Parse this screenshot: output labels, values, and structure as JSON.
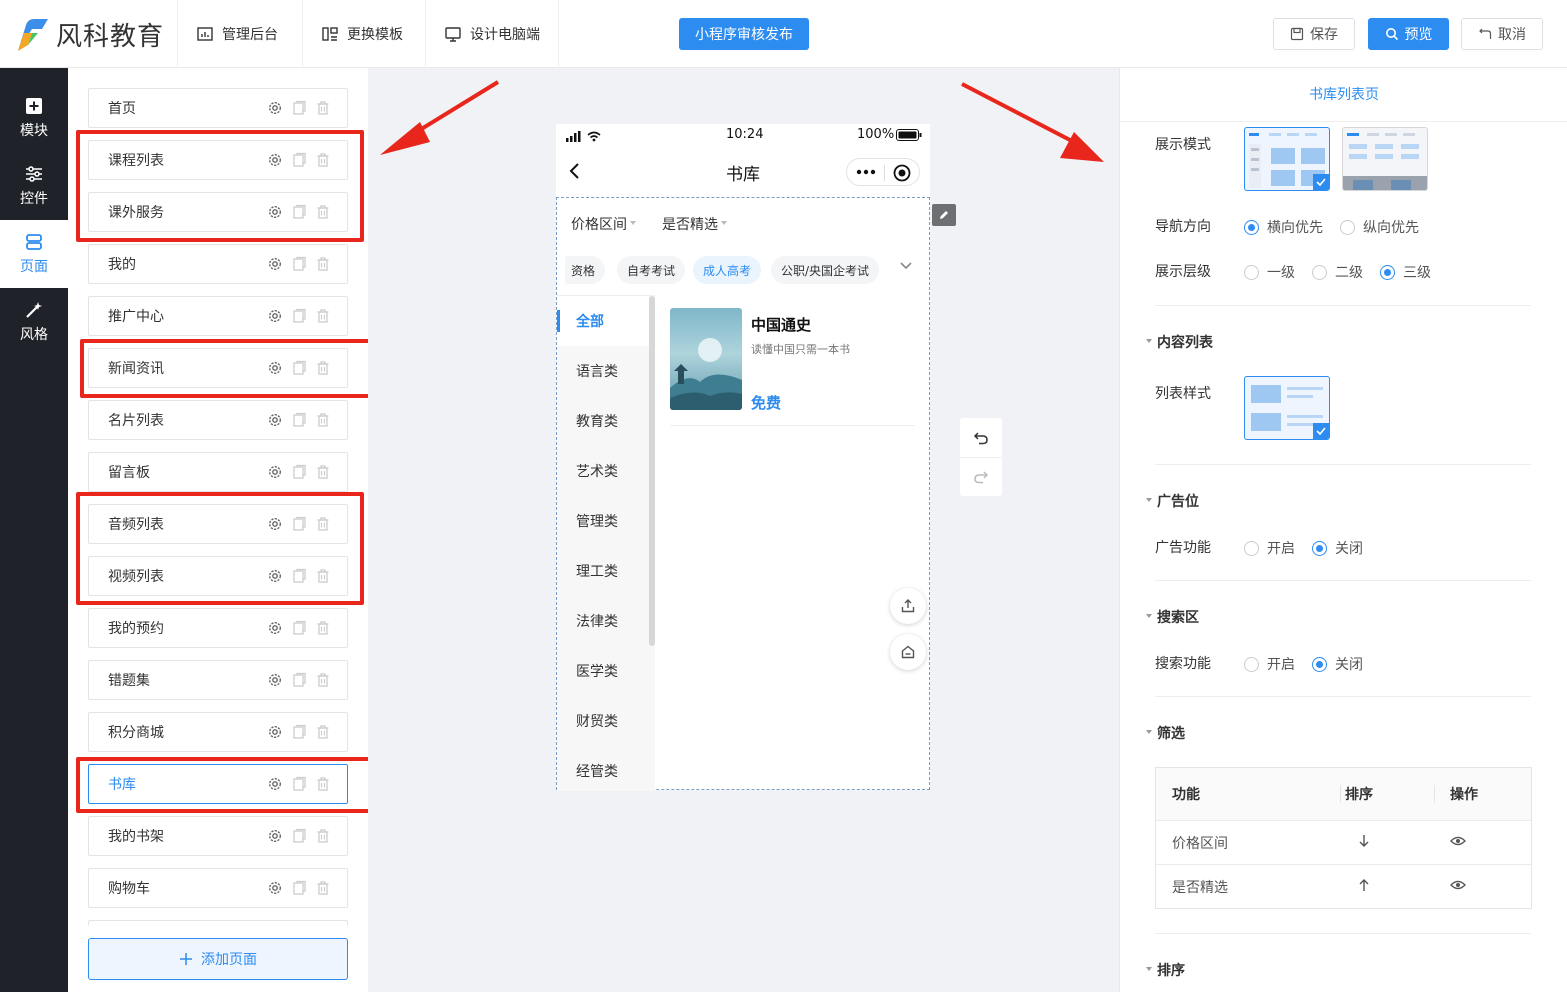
{
  "topbar": {
    "logo_text": "风科教育",
    "nav": [
      "管理后台",
      "更换模板",
      "设计电脑端"
    ],
    "publish_label": "小程序审核发布",
    "save_label": "保存",
    "preview_label": "预览",
    "cancel_label": "取消"
  },
  "sidebar": {
    "items": [
      "模块",
      "控件",
      "页面",
      "风格"
    ],
    "active": "页面",
    "help_label": "?"
  },
  "pages": {
    "items": [
      "首页",
      "课程列表",
      "课外服务",
      "我的",
      "推广中心",
      "新闻资讯",
      "名片列表",
      "留言板",
      "音频列表",
      "视频列表",
      "我的预约",
      "错题集",
      "积分商城",
      "书库",
      "我的书架",
      "购物车"
    ],
    "active": "书库",
    "add_label": "添加页面"
  },
  "phone": {
    "time": "10:24",
    "battery": "100%",
    "title": "书库",
    "filters": [
      "价格区间",
      "是否精选"
    ],
    "chips": [
      "资格",
      "自考考试",
      "成人高考",
      "公职/央国企考试"
    ],
    "active_chip": "成人高考",
    "categories": [
      "全部",
      "语言类",
      "教育类",
      "艺术类",
      "管理类",
      "理工类",
      "法律类",
      "医学类",
      "财贸类",
      "经管类"
    ],
    "active_category": "全部",
    "book": {
      "title": "中国通史",
      "subtitle": "读懂中国只需一本书",
      "price": "免费"
    }
  },
  "settings": {
    "title": "书库列表页",
    "display_mode_label": "展示模式",
    "nav_direction_label": "导航方向",
    "nav_options": [
      "横向优先",
      "纵向优先"
    ],
    "nav_selected": "横向优先",
    "level_label": "展示层级",
    "level_options": [
      "一级",
      "二级",
      "三级"
    ],
    "level_selected": "三级",
    "content_section": "内容列表",
    "list_style_label": "列表样式",
    "ad_section": "广告位",
    "ad_label": "广告功能",
    "ad_options": [
      "开启",
      "关闭"
    ],
    "ad_selected": "关闭",
    "search_section": "搜索区",
    "search_label": "搜索功能",
    "search_options": [
      "开启",
      "关闭"
    ],
    "search_selected": "关闭",
    "filter_section": "筛选",
    "filter_table": {
      "headers": [
        "功能",
        "排序",
        "操作"
      ],
      "rows": [
        {
          "name": "价格区间",
          "sort": "down"
        },
        {
          "name": "是否精选",
          "sort": "up"
        }
      ]
    },
    "sort_section": "排序"
  },
  "colors": {
    "accent": "#2d8cf0",
    "annotation": "#e8261c",
    "sidebar_bg": "#1f2329"
  }
}
